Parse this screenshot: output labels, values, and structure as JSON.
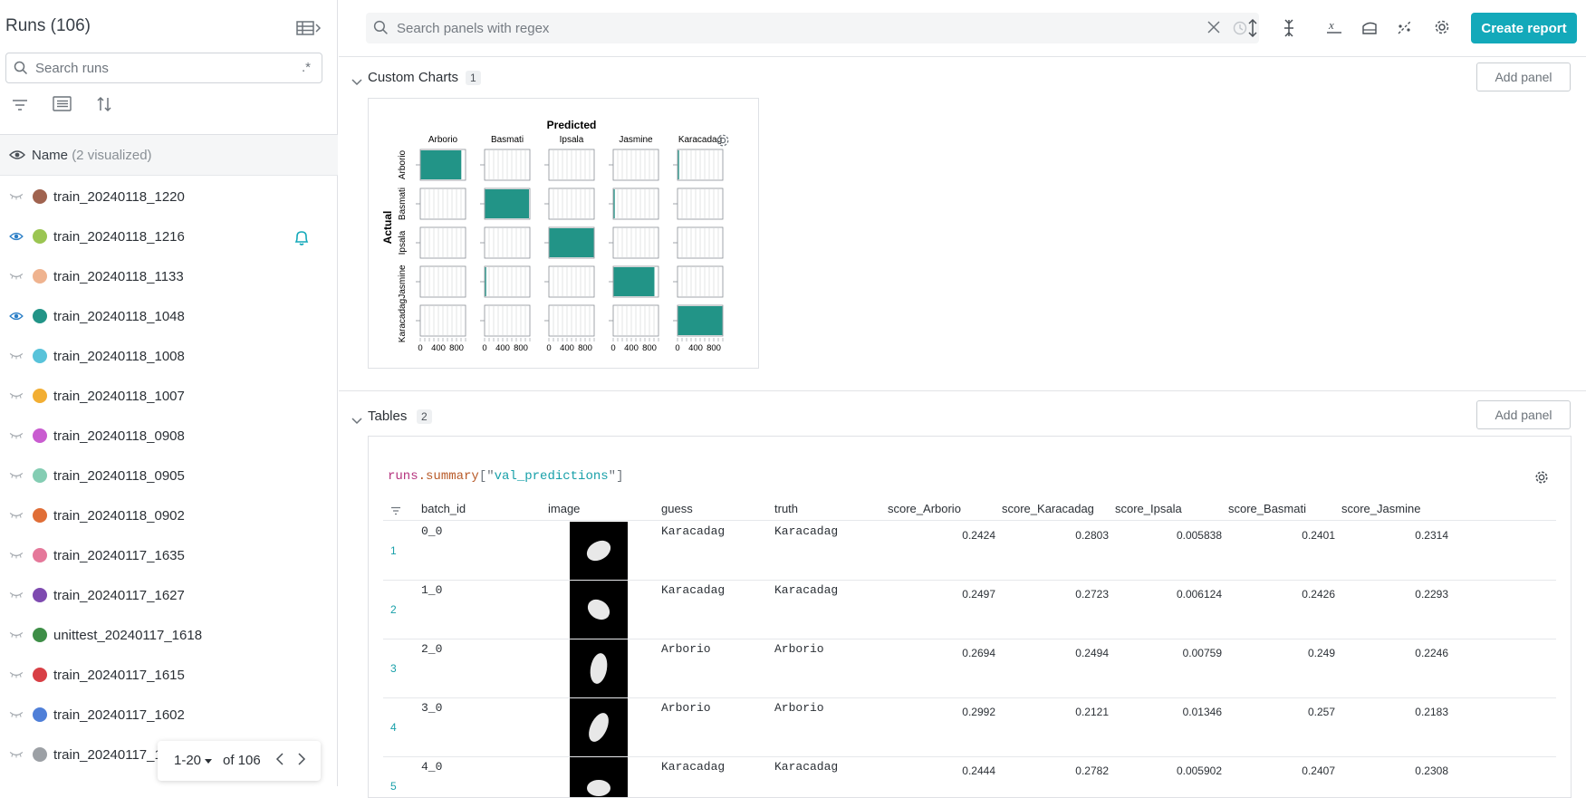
{
  "sidebar": {
    "title": "Runs (106)",
    "search_placeholder": "Search runs",
    "regex_label": ".*",
    "name_header": "Name",
    "name_header_sub": "(2 visualized)",
    "runs": [
      {
        "name": "train_20240118_1220",
        "color": "#a0634f",
        "visible": false,
        "bell": false
      },
      {
        "name": "train_20240118_1216",
        "color": "#9bc552",
        "visible": true,
        "bell": true
      },
      {
        "name": "train_20240118_1133",
        "color": "#efb38f",
        "visible": false,
        "bell": false
      },
      {
        "name": "train_20240118_1048",
        "color": "#229487",
        "visible": true,
        "bell": false
      },
      {
        "name": "train_20240118_1008",
        "color": "#58c3da",
        "visible": false,
        "bell": false
      },
      {
        "name": "train_20240118_1007",
        "color": "#f2ae33",
        "visible": false,
        "bell": false
      },
      {
        "name": "train_20240118_0908",
        "color": "#c95cd0",
        "visible": false,
        "bell": false
      },
      {
        "name": "train_20240118_0905",
        "color": "#84cdb3",
        "visible": false,
        "bell": false
      },
      {
        "name": "train_20240118_0902",
        "color": "#e06e37",
        "visible": false,
        "bell": false
      },
      {
        "name": "train_20240117_1635",
        "color": "#e5789a",
        "visible": false,
        "bell": false
      },
      {
        "name": "train_20240117_1627",
        "color": "#7e4ab0",
        "visible": false,
        "bell": false
      },
      {
        "name": "unittest_20240117_1618",
        "color": "#3e8e47",
        "visible": false,
        "bell": false
      },
      {
        "name": "train_20240117_1615",
        "color": "#d83f45",
        "visible": false,
        "bell": false
      },
      {
        "name": "train_20240117_1602",
        "color": "#4f7fd8",
        "visible": false,
        "bell": false
      },
      {
        "name": "train_20240117_1",
        "color": "#9ca0a5",
        "visible": false,
        "bell": false
      }
    ],
    "pager": {
      "range": "1-20",
      "of": "of 106"
    }
  },
  "topbar": {
    "search_placeholder": "Search panels with regex",
    "create_report": "Create report"
  },
  "sections": {
    "custom_charts": {
      "title": "Custom Charts",
      "count": "1",
      "add_panel": "Add panel"
    },
    "tables": {
      "title": "Tables",
      "count": "2",
      "add_panel": "Add panel"
    }
  },
  "chart_data": {
    "type": "bar",
    "title": "Predicted",
    "ylabel": "Actual",
    "classes": [
      "Arborio",
      "Basmati",
      "Ipsala",
      "Jasmine",
      "Karacadag"
    ],
    "x_ticks": [
      "0",
      "400",
      "800"
    ],
    "xlim": [
      0,
      1000
    ],
    "bar_color": "#229487",
    "matrix": [
      [
        915,
        0,
        0,
        0,
        5
      ],
      [
        0,
        990,
        0,
        5,
        0
      ],
      [
        0,
        0,
        1000,
        0,
        0
      ],
      [
        0,
        45,
        0,
        920,
        0
      ],
      [
        0,
        0,
        0,
        0,
        1000
      ]
    ]
  },
  "table": {
    "query": {
      "a": "runs",
      "b": ".summary",
      "c": "[\"",
      "d": "val_predictions",
      "e": "\"]"
    },
    "columns": [
      "batch_id",
      "image",
      "guess",
      "truth",
      "score_Arborio",
      "score_Karacadag",
      "score_Ipsala",
      "score_Basmati",
      "score_Jasmine"
    ],
    "rows": [
      {
        "idx": "1",
        "batch_id": "0_0",
        "guess": "Karacadag",
        "truth": "Karacadag",
        "score_Arborio": "0.2424",
        "score_Karacadag": "0.2803",
        "score_Ipsala": "0.005838",
        "score_Basmati": "0.2401",
        "score_Jasmine": "0.2314"
      },
      {
        "idx": "2",
        "batch_id": "1_0",
        "guess": "Karacadag",
        "truth": "Karacadag",
        "score_Arborio": "0.2497",
        "score_Karacadag": "0.2723",
        "score_Ipsala": "0.006124",
        "score_Basmati": "0.2426",
        "score_Jasmine": "0.2293"
      },
      {
        "idx": "3",
        "batch_id": "2_0",
        "guess": "Arborio",
        "truth": "Arborio",
        "score_Arborio": "0.2694",
        "score_Karacadag": "0.2494",
        "score_Ipsala": "0.00759",
        "score_Basmati": "0.249",
        "score_Jasmine": "0.2246"
      },
      {
        "idx": "4",
        "batch_id": "3_0",
        "guess": "Arborio",
        "truth": "Arborio",
        "score_Arborio": "0.2992",
        "score_Karacadag": "0.2121",
        "score_Ipsala": "0.01346",
        "score_Basmati": "0.257",
        "score_Jasmine": "0.2183"
      },
      {
        "idx": "5",
        "batch_id": "4_0",
        "guess": "Karacadag",
        "truth": "Karacadag",
        "score_Arborio": "0.2444",
        "score_Karacadag": "0.2782",
        "score_Ipsala": "0.005902",
        "score_Basmati": "0.2407",
        "score_Jasmine": "0.2308"
      }
    ]
  }
}
